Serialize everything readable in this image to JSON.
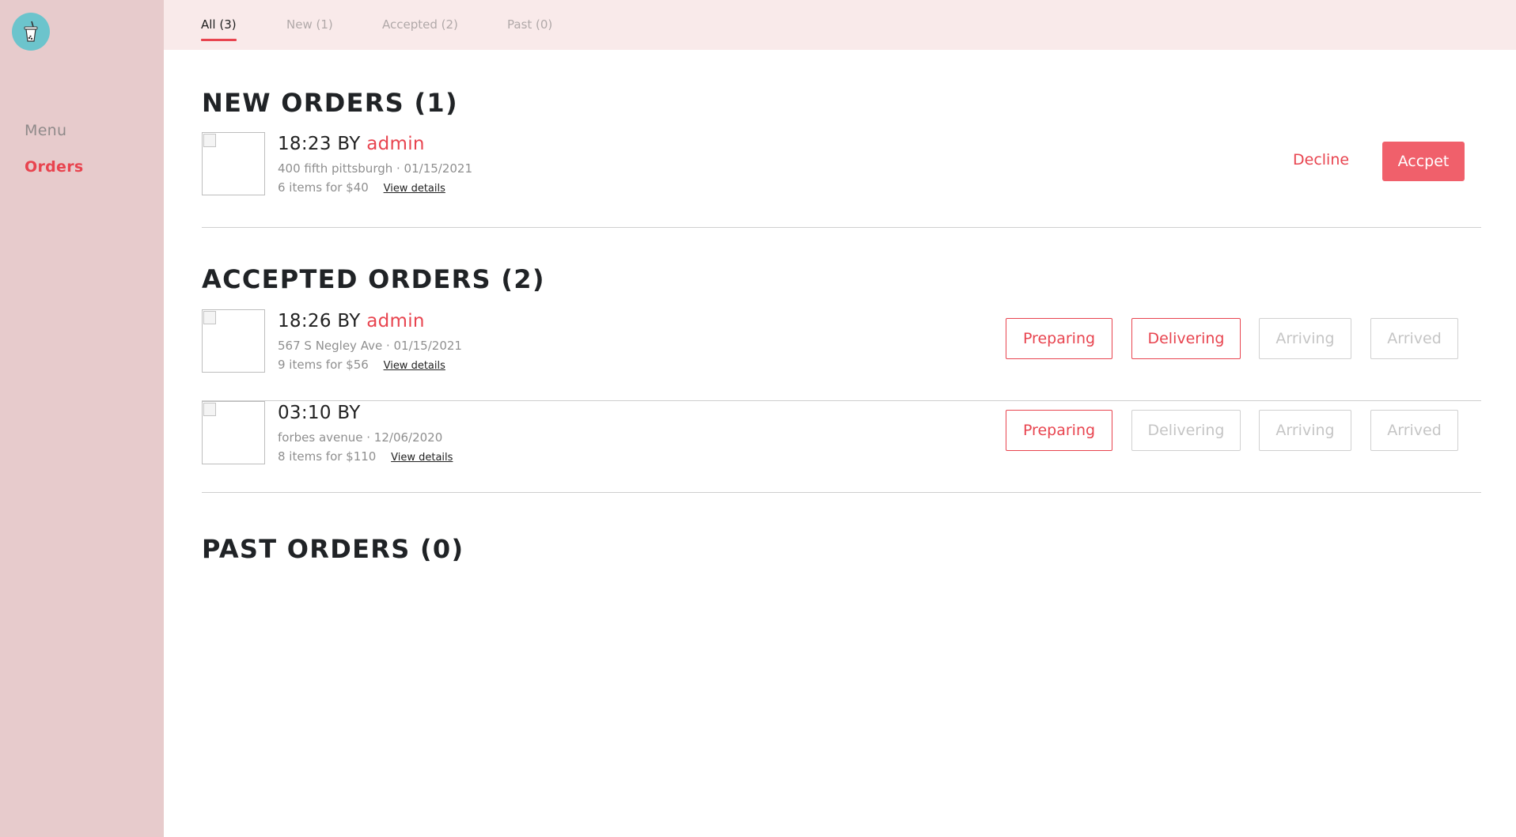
{
  "sidebar": {
    "logo_icon": "bubble-tea-cup-icon",
    "items": [
      {
        "label": "Menu"
      },
      {
        "label": "Orders"
      }
    ]
  },
  "tabs": [
    {
      "label": "All (3)"
    },
    {
      "label": "New (1)"
    },
    {
      "label": "Accepted (2)"
    },
    {
      "label": "Past (0)"
    }
  ],
  "sections": {
    "new_title": "NEW ORDERS (1)",
    "accepted_title": "ACCEPTED ORDERS (2)",
    "past_title": "PAST ORDERS (0)"
  },
  "orders": [
    {
      "time": "18:23",
      "by": "BY",
      "user": "admin",
      "address_date": "400 fifth pittsburgh · 01/15/2021",
      "items_price": "6 items for $40",
      "details_label": "View details",
      "decline_label": "Decline",
      "accept_label": "Accpet"
    },
    {
      "time": "18:26",
      "by": "BY",
      "user": "admin",
      "address_date": "567 S Negley Ave · 01/15/2021",
      "items_price": "9 items for $56",
      "details_label": "View details",
      "status": "Delivering"
    },
    {
      "time": "03:10",
      "by": "BY",
      "user": "",
      "address_date": "forbes avenue · 12/06/2020",
      "items_price": "8 items for $110",
      "details_label": "View details",
      "status": "Preparing"
    }
  ],
  "status_labels": {
    "preparing": "Preparing",
    "delivering": "Delivering",
    "arriving": "Arriving",
    "arrived": "Arrived"
  },
  "colors": {
    "accent": "#e8444f",
    "sidebar_bg": "#e7cbcc",
    "tabbar_bg": "#f9eaea",
    "logo_bg": "#6cc4cc"
  }
}
